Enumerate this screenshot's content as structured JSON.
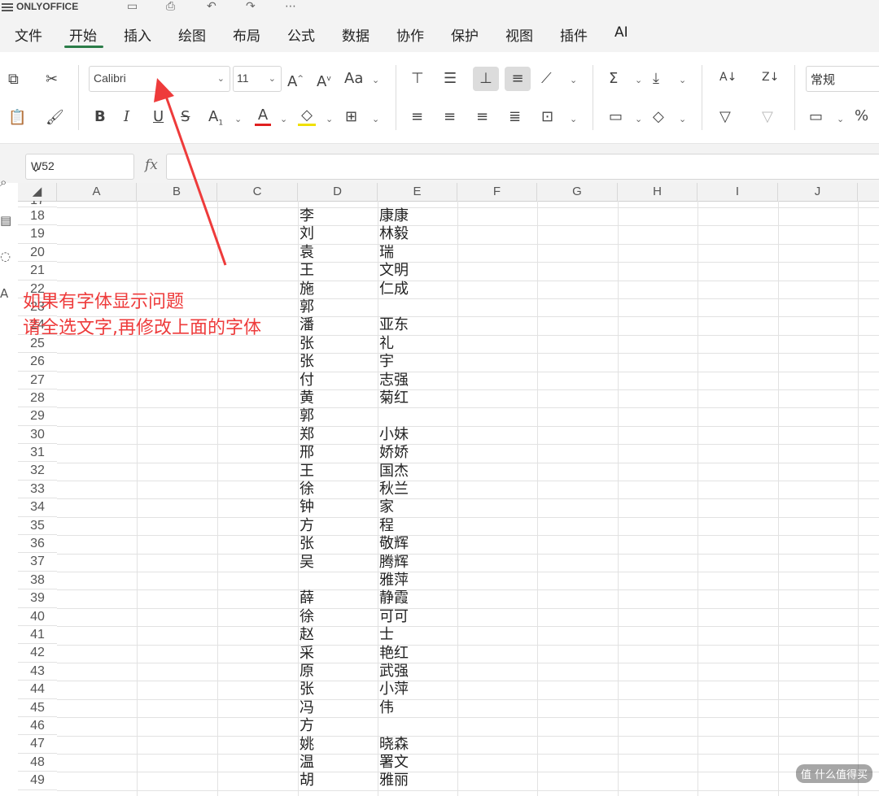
{
  "app": {
    "name": "ONLYOFFICE"
  },
  "menu_tabs": [
    "文件",
    "开始",
    "插入",
    "绘图",
    "布局",
    "公式",
    "数据",
    "协作",
    "保护",
    "视图",
    "插件",
    "AI"
  ],
  "active_tab": "开始",
  "toolbar": {
    "font_name": "Calibri",
    "font_size": "11",
    "number_format": "常规",
    "percent": "%"
  },
  "formula_bar": {
    "name_box": "W52",
    "fx": "fx",
    "formula": ""
  },
  "columns": [
    "A",
    "B",
    "C",
    "D",
    "E",
    "F",
    "G",
    "H",
    "I",
    "J"
  ],
  "rows": [
    {
      "num": "17",
      "d": "",
      "e": ""
    },
    {
      "num": "18",
      "d": "李",
      "e": "康康"
    },
    {
      "num": "19",
      "d": "刘",
      "e": "林毅"
    },
    {
      "num": "20",
      "d": "袁",
      "e": "瑞"
    },
    {
      "num": "21",
      "d": "王",
      "e": "文明"
    },
    {
      "num": "22",
      "d": "施",
      "e": "仁成"
    },
    {
      "num": "23",
      "d": "郭",
      "e": ""
    },
    {
      "num": "24",
      "d": "潘",
      "e": "亚东"
    },
    {
      "num": "25",
      "d": "张",
      "e": "礼"
    },
    {
      "num": "26",
      "d": "张",
      "e": "宇"
    },
    {
      "num": "27",
      "d": "付",
      "e": "志强"
    },
    {
      "num": "28",
      "d": "黄",
      "e": "菊红"
    },
    {
      "num": "29",
      "d": "郭",
      "e": ""
    },
    {
      "num": "30",
      "d": "郑",
      "e": "小妹"
    },
    {
      "num": "31",
      "d": "邢",
      "e": "娇娇"
    },
    {
      "num": "32",
      "d": "王",
      "e": "国杰"
    },
    {
      "num": "33",
      "d": "徐",
      "e": "秋兰"
    },
    {
      "num": "34",
      "d": "钟",
      "e": "家"
    },
    {
      "num": "35",
      "d": "方",
      "e": "程"
    },
    {
      "num": "36",
      "d": "张",
      "e": "敬辉"
    },
    {
      "num": "37",
      "d": "吴",
      "e": "腾辉"
    },
    {
      "num": "38",
      "d": "",
      "e": "雅萍"
    },
    {
      "num": "39",
      "d": "薛",
      "e": "静霞"
    },
    {
      "num": "40",
      "d": "徐",
      "e": "可可"
    },
    {
      "num": "41",
      "d": "赵",
      "e": "士"
    },
    {
      "num": "42",
      "d": "采",
      "e": "艳红"
    },
    {
      "num": "43",
      "d": "原",
      "e": "武强"
    },
    {
      "num": "44",
      "d": "张",
      "e": "小萍"
    },
    {
      "num": "45",
      "d": "冯",
      "e": "伟"
    },
    {
      "num": "46",
      "d": "方",
      "e": ""
    },
    {
      "num": "47",
      "d": "姚",
      "e": "晓森"
    },
    {
      "num": "48",
      "d": "温",
      "e": "署文"
    },
    {
      "num": "49",
      "d": "胡",
      "e": "雅丽"
    }
  ],
  "annotation": {
    "line1": "如果有字体显示问题",
    "line2": "请全选文字,再修改上面的字体",
    "color": "#ee3b3b"
  },
  "watermark": "值 什么值得买",
  "colors": {
    "accent": "#2b7d48",
    "annotation": "#ee3b3b"
  }
}
